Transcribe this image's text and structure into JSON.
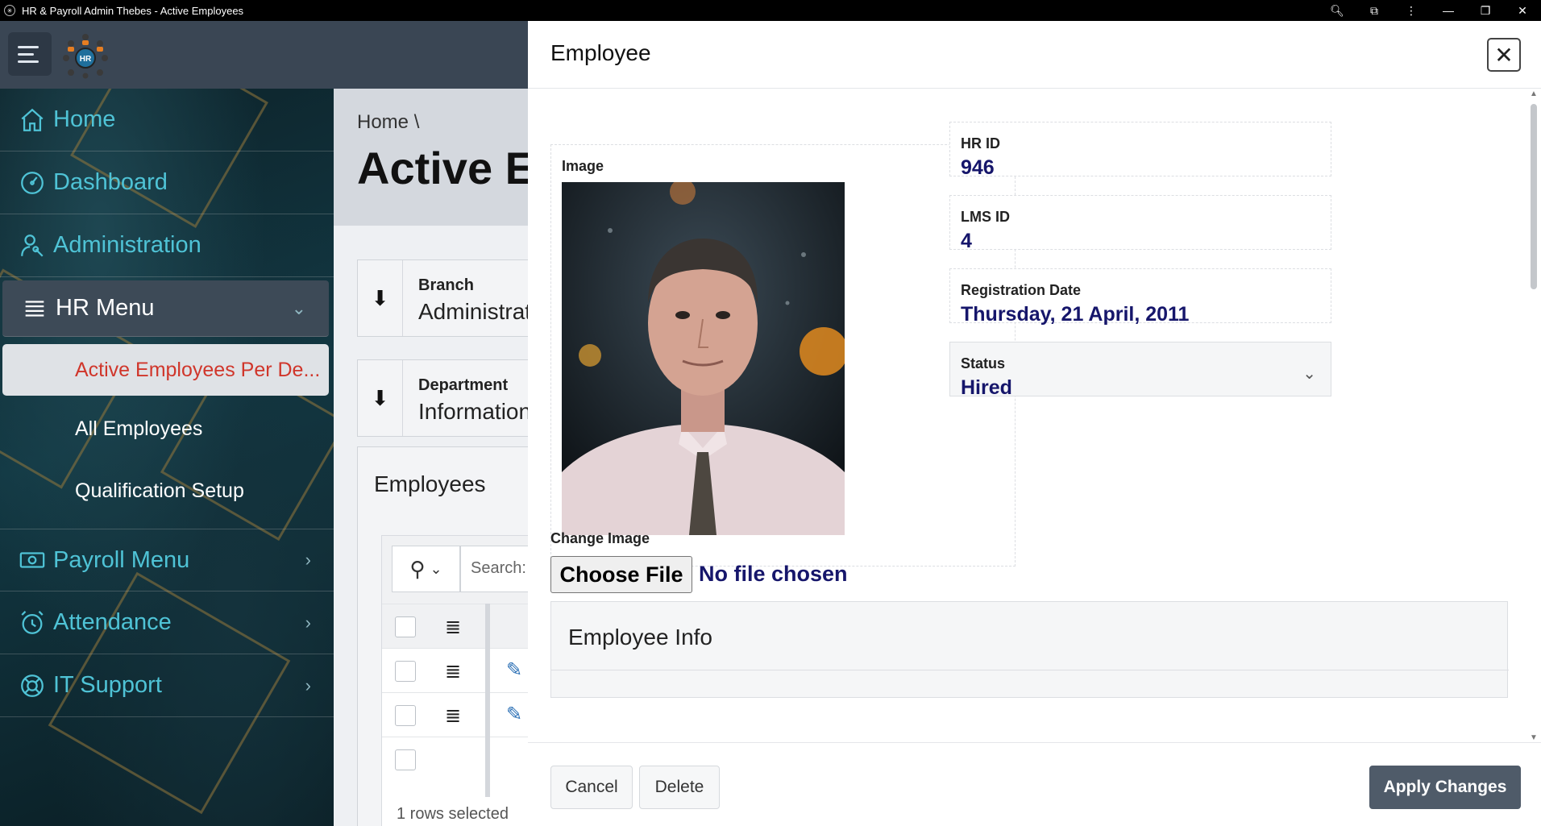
{
  "window": {
    "title": "HR & Payroll Admin Thebes - Active Employees"
  },
  "sidebar": {
    "items": [
      {
        "label": "Home"
      },
      {
        "label": "Dashboard"
      },
      {
        "label": "Administration"
      },
      {
        "label": "HR Menu"
      },
      {
        "label": "Active Employees Per De..."
      },
      {
        "label": "All Employees"
      },
      {
        "label": "Qualification Setup"
      },
      {
        "label": "Payroll Menu"
      },
      {
        "label": "Attendance"
      },
      {
        "label": "IT Support"
      }
    ]
  },
  "main": {
    "breadcrumb": "Home  \\",
    "title": "Active Employees",
    "facets": [
      {
        "label": "Branch",
        "value": "Administration"
      },
      {
        "label": "Department",
        "value": "Information"
      }
    ],
    "employees_title": "Employees",
    "search_placeholder": "Search:",
    "rows_selected": "1 rows selected"
  },
  "dialog": {
    "title": "Employee",
    "image_label": "Image",
    "hr_id": {
      "label": "HR ID",
      "value": "946"
    },
    "lms_id": {
      "label": "LMS ID",
      "value": "4"
    },
    "registration_date": {
      "label": "Registration Date",
      "value": "Thursday, 21 April, 2011"
    },
    "status": {
      "label": "Status",
      "value": "Hired"
    },
    "change_image_label": "Change Image",
    "choose_file": "Choose File",
    "no_file": "No file chosen",
    "employee_info_title": "Employee Info",
    "buttons": {
      "cancel": "Cancel",
      "delete": "Delete",
      "apply": "Apply Changes"
    }
  },
  "colors": {
    "accent": "#4fc3d6",
    "value_text": "#16166b",
    "active_item": "#d0362b",
    "apply_button": "#4f5b69"
  }
}
